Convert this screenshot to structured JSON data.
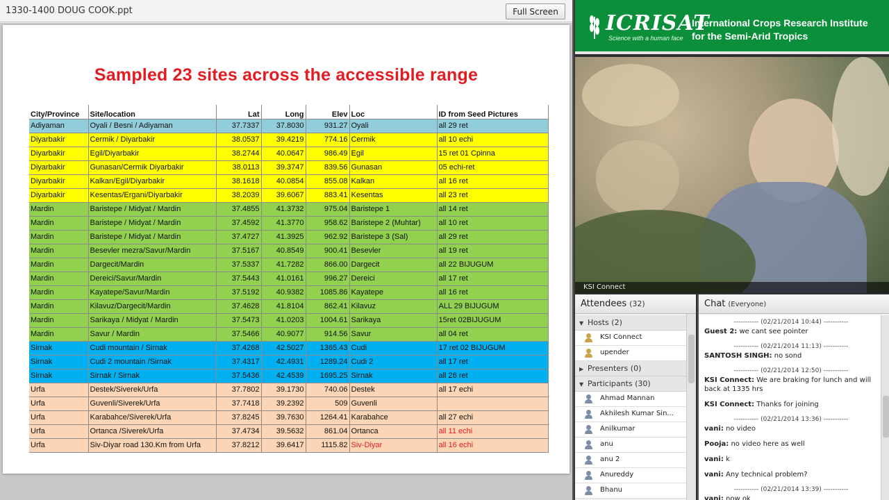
{
  "share": {
    "title": "1330-1400 DOUG COOK.ppt",
    "full_screen_label": "Full Screen"
  },
  "slide": {
    "title": "Sampled 23 sites across the accessible range",
    "table": {
      "headers": [
        "City/Province",
        "Site/location",
        "Lat",
        "Long",
        "Elev",
        "Loc",
        "ID from Seed Pictures"
      ],
      "rows": [
        {
          "province": "Adiyaman",
          "site": "Oyali / Besni / Adiyaman",
          "lat": "37.7337",
          "long": "37.8030",
          "elev": "931.27",
          "loc": "Oyali",
          "id": "all 29 ret",
          "bg": "#92cddc"
        },
        {
          "province": "Diyarbakir",
          "site": "Cermik / Diyarbakir",
          "lat": "38.0537",
          "long": "39.4219",
          "elev": "774.16",
          "loc": "Cermik",
          "id": "all 10 echi",
          "bg": "#ffff00"
        },
        {
          "province": "Diyarbakir",
          "site": "Egil/Diyarbakir",
          "lat": "38.2744",
          "long": "40.0647",
          "elev": "986.49",
          "loc": "Egil",
          "id": "15 ret 01 Cpinna",
          "bg": "#ffff00"
        },
        {
          "province": "Diyarbakir",
          "site": "Gunasan/Cermik Diyarbakir",
          "lat": "38.0113",
          "long": "39.3747",
          "elev": "839.56",
          "loc": "Gunasan",
          "id": "05 echi-ret",
          "bg": "#ffff00"
        },
        {
          "province": "Diyarbakir",
          "site": "Kalkan/Egil/Diyarbakir",
          "lat": "38.1618",
          "long": "40.0854",
          "elev": "855.08",
          "loc": "Kalkan",
          "id": "all 16 ret",
          "bg": "#ffff00"
        },
        {
          "province": "Diyarbakir",
          "site": "Kesentas/Ergani/Diyarbakir",
          "lat": "38.2039",
          "long": "39.6067",
          "elev": "883.41",
          "loc": "Kesentas",
          "id": "all 23 ret",
          "bg": "#ffff00"
        },
        {
          "province": "Mardin",
          "site": "Baristepe / Midyat / Mardin",
          "lat": "37.4855",
          "long": "41.3732",
          "elev": "975.04",
          "loc": "Baristepe 1",
          "id": "all 14 ret",
          "bg": "#92d050"
        },
        {
          "province": "Mardin",
          "site": "Baristepe / Midyat / Mardin",
          "lat": "37.4592",
          "long": "41.3770",
          "elev": "958.62",
          "loc": "Baristepe 2 (Muhtar)",
          "id": "all 10 ret",
          "bg": "#92d050"
        },
        {
          "province": "Mardin",
          "site": "Baristepe / Midyat / Mardin",
          "lat": "37.4727",
          "long": "41.3925",
          "elev": "962.92",
          "loc": "Baristepe 3 (Sal)",
          "id": "all 29 ret",
          "bg": "#92d050"
        },
        {
          "province": "Mardin",
          "site": "Besevler mezra/Savur/Mardin",
          "lat": "37.5167",
          "long": "40.8549",
          "elev": "900.41",
          "loc": "Besevler",
          "id": "all 19 ret",
          "bg": "#92d050"
        },
        {
          "province": "Mardin",
          "site": "Dargecit/Mardin",
          "lat": "37.5337",
          "long": "41.7282",
          "elev": "866.00",
          "loc": "Dargecit",
          "id": "all 22 BIJUGUM",
          "bg": "#92d050"
        },
        {
          "province": "Mardin",
          "site": "Dereici/Savur/Mardin",
          "lat": "37.5443",
          "long": "41.0161",
          "elev": "996.27",
          "loc": "Dereici",
          "id": "all 17 ret",
          "bg": "#92d050"
        },
        {
          "province": "Mardin",
          "site": "Kayatepe/Savur/Mardin",
          "lat": "37.5192",
          "long": "40.9382",
          "elev": "1085.86",
          "loc": "Kayatepe",
          "id": "all 16 ret",
          "bg": "#92d050"
        },
        {
          "province": "Mardin",
          "site": "Kilavuz/Dargecit/Mardin",
          "lat": "37.4628",
          "long": "41.8104",
          "elev": "862.41",
          "loc": "Kilavuz",
          "id": "ALL 29 BIJUGUM",
          "bg": "#92d050"
        },
        {
          "province": "Mardin",
          "site": "Sarikaya / Midyat / Mardin",
          "lat": "37.5473",
          "long": "41.0203",
          "elev": "1004.61",
          "loc": "Sarikaya",
          "id": "15ret 02BIJUGUM",
          "bg": "#92d050"
        },
        {
          "province": "Mardin",
          "site": "Savur / Mardin",
          "lat": "37.5466",
          "long": "40.9077",
          "elev": "914.56",
          "loc": "Savur",
          "id": "all 04 ret",
          "bg": "#92d050"
        },
        {
          "province": "Sirnak",
          "site": "Cudi mountain / Sirnak",
          "lat": "37.4268",
          "long": "42.5027",
          "elev": "1365.43",
          "loc": "Cudi",
          "id": "17 ret 02 BIJUGUM",
          "bg": "#00b0f0"
        },
        {
          "province": "Sirnak",
          "site": "Cudi 2 mountain /Sirnak",
          "lat": "37.4317",
          "long": "42.4931",
          "elev": "1289.24",
          "loc": "Cudi 2",
          "id": "all 17 ret",
          "bg": "#00b0f0"
        },
        {
          "province": "Sirnak",
          "site": "Sirnak / Sirnak",
          "lat": "37.5436",
          "long": "42.4539",
          "elev": "1695.25",
          "loc": "Sirnak",
          "id": "all 26 ret",
          "bg": "#00b0f0"
        },
        {
          "province": "Urfa",
          "site": "Destek/Siverek/Urfa",
          "lat": "37.7802",
          "long": "39.1730",
          "elev": "740.06",
          "loc": "Destek",
          "id": "all 17 echi",
          "bg": "#fbd5b5"
        },
        {
          "province": "Urfa",
          "site": "Guvenli/Siverek/Urfa",
          "lat": "37.7418",
          "long": "39.2392",
          "elev": "509",
          "loc": "Guvenli",
          "id": "",
          "bg": "#fbd5b5"
        },
        {
          "province": "Urfa",
          "site": "Karabahce/Siverek/Urfa",
          "lat": "37.8245",
          "long": "39.7630",
          "elev": "1264.41",
          "loc": "Karabahce",
          "id": "all 27 echi",
          "bg": "#fbd5b5"
        },
        {
          "province": "Urfa",
          "site": "Ortanca /Siverek/Urfa",
          "lat": "37.4734",
          "long": "39.5632",
          "elev": "861.04",
          "loc": "Ortanca",
          "id": "all 11 echi",
          "bg": "#fbd5b5",
          "id_red": true
        },
        {
          "province": "Urfa",
          "site": "Siv-Diyar road 130.Km from Urfa",
          "lat": "37.8212",
          "long": "39.6417",
          "elev": "1115.82",
          "loc": "Siv-Diyar",
          "id": "all 16 echi",
          "bg": "#fbd5b5",
          "id_red": true,
          "loc_red": true
        }
      ]
    }
  },
  "banner": {
    "logo": "ICRISAT",
    "tagline": "Science with a human face",
    "line1": "International Crops Research Institute",
    "line2": "for the Semi-Arid Tropics"
  },
  "video": {
    "label": "KSI Connect"
  },
  "attendees": {
    "title": "Attendees",
    "count": "(32)",
    "hosts_label": "Hosts (2)",
    "hosts": [
      "KSI Connect",
      "upender"
    ],
    "presenters_label": "Presenters (0)",
    "participants_label": "Participants (30)",
    "participants": [
      "Ahmad Mannan",
      "Akhilesh Kumar Sin...",
      "Anilkumar",
      "anu",
      "anu 2",
      "Anureddy",
      "Bhanu"
    ]
  },
  "chat": {
    "title": "Chat",
    "scope": "(Everyone)",
    "items": [
      {
        "type": "ts",
        "text": "----------- (02/21/2014 10:44) -----------"
      },
      {
        "type": "msg",
        "who": "Guest 2:",
        "text": "we cant see pointer"
      },
      {
        "type": "ts",
        "text": "----------- (02/21/2014 11:13) -----------"
      },
      {
        "type": "msg",
        "who": "SANTOSH SINGH:",
        "text": "no sond"
      },
      {
        "type": "ts",
        "text": "----------- (02/21/2014 12:50) -----------"
      },
      {
        "type": "msg",
        "who": "KSI Connect:",
        "text": "We are braking for lunch and will back at 1335 hrs"
      },
      {
        "type": "msg",
        "who": "KSI Connect:",
        "text": "Thanks for joining"
      },
      {
        "type": "ts",
        "text": "----------- (02/21/2014 13:36) -----------"
      },
      {
        "type": "msg",
        "who": "vani:",
        "text": "no video"
      },
      {
        "type": "msg",
        "who": "Pooja:",
        "text": "no video here as well"
      },
      {
        "type": "msg",
        "who": "vani:",
        "text": "k"
      },
      {
        "type": "msg",
        "who": "vani:",
        "text": "Any technical problem?"
      },
      {
        "type": "ts",
        "text": "----------- (02/21/2014 13:39) -----------"
      },
      {
        "type": "msg",
        "who": "vani:",
        "text": "now ok"
      }
    ]
  }
}
